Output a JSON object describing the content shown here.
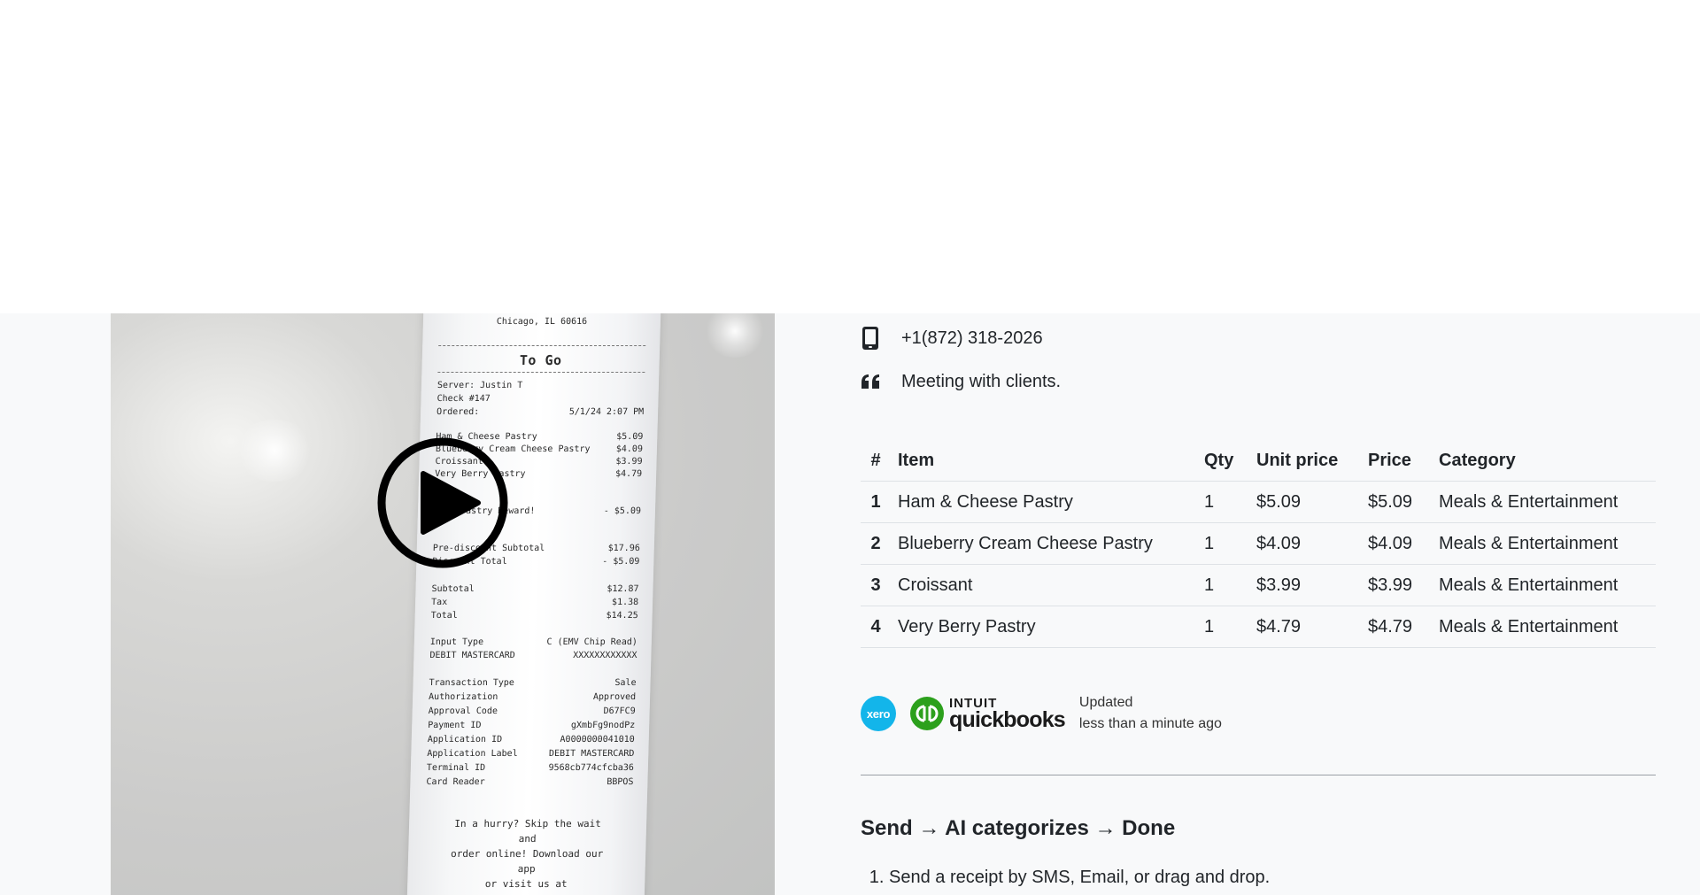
{
  "receipt": {
    "address": "Chicago, IL 60616",
    "order_type": "To Go",
    "server": "Server: Justin T",
    "check": "Check #147",
    "ordered_label": "Ordered:",
    "ordered_value": "5/1/24 2:07 PM",
    "lines": [
      {
        "name": "Ham & Cheese Pastry",
        "price": "$5.09"
      },
      {
        "name": "Blueberry Cream Cheese Pastry",
        "price": "$4.09"
      },
      {
        "name": "Croissant",
        "price": "$3.99"
      },
      {
        "name": "Very Berry Pastry",
        "price": "$4.79"
      }
    ],
    "reward": {
      "name": "Free Pastry Reward!",
      "price": "- $5.09"
    },
    "pre_discount": {
      "name": "Pre-discount Subtotal",
      "price": "$17.96"
    },
    "discount_total": {
      "name": "Discount Total",
      "price": "- $5.09"
    },
    "subtotal": {
      "name": "Subtotal",
      "price": "$12.87"
    },
    "tax": {
      "name": "Tax",
      "price": "$1.38"
    },
    "total": {
      "name": "Total",
      "price": "$14.25"
    },
    "input_type": {
      "name": "Input Type",
      "value": "C (EMV Chip Read)"
    },
    "card": {
      "name": "DEBIT MASTERCARD",
      "value": "XXXXXXXXXXXX"
    },
    "txn": [
      {
        "name": "Transaction Type",
        "value": "Sale"
      },
      {
        "name": "Authorization",
        "value": "Approved"
      },
      {
        "name": "Approval Code",
        "value": "D67FC9"
      },
      {
        "name": "Payment ID",
        "value": "gXmbFg9nodPz"
      },
      {
        "name": "Application ID",
        "value": "A0000000041010"
      },
      {
        "name": "Application Label",
        "value": "DEBIT MASTERCARD"
      },
      {
        "name": "Terminal ID",
        "value": "9568cb774cfcba36"
      },
      {
        "name": "Card Reader",
        "value": "BBPOS"
      }
    ],
    "footer": [
      "In a hurry? Skip the wait",
      "and",
      "order online! Download our",
      "app",
      "or visit us at"
    ]
  },
  "details": {
    "phone": "+1(872) 318-2026",
    "note": "Meeting with clients."
  },
  "table": {
    "headers": {
      "num": "#",
      "item": "Item",
      "qty": "Qty",
      "unit": "Unit price",
      "price": "Price",
      "category": "Category"
    },
    "rows": [
      {
        "num": "1",
        "item": "Ham & Cheese Pastry",
        "qty": "1",
        "unit": "$5.09",
        "price": "$5.09",
        "category": "Meals & Entertainment"
      },
      {
        "num": "2",
        "item": "Blueberry Cream Cheese Pastry",
        "qty": "1",
        "unit": "$4.09",
        "price": "$4.09",
        "category": "Meals & Entertainment"
      },
      {
        "num": "3",
        "item": "Croissant",
        "qty": "1",
        "unit": "$3.99",
        "price": "$3.99",
        "category": "Meals & Entertainment"
      },
      {
        "num": "4",
        "item": "Very Berry Pastry",
        "qty": "1",
        "unit": "$4.79",
        "price": "$4.79",
        "category": "Meals & Entertainment"
      }
    ]
  },
  "integrations": {
    "xero_label": "xero",
    "qb_intuit": "INTUIT",
    "qb_name": "quickbooks",
    "updated_label": "Updated",
    "updated_value": "less than a minute ago"
  },
  "steps": {
    "title": "Send → AI categorizes → Done",
    "items": [
      "Send a receipt by SMS, Email, or drag and drop."
    ]
  },
  "colors": {
    "xero": "#13b5ea",
    "quickbooks": "#2ca01c",
    "text": "#212529",
    "background": "#f8f9fa"
  },
  "icons": [
    "phone-icon",
    "quote-icon",
    "play-icon"
  ]
}
